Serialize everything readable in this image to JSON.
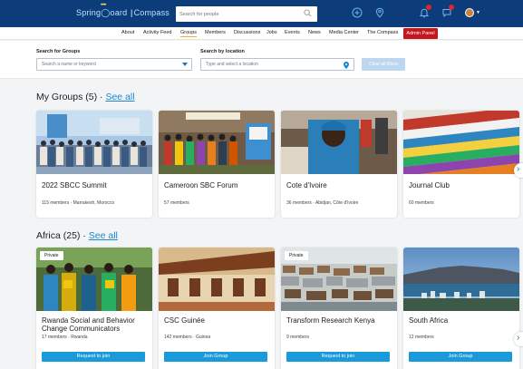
{
  "header": {
    "logo_part1": "Spring",
    "logo_part2": "oard",
    "logo_sep": "|",
    "logo_part3": "Compass",
    "search_placeholder": "Search for people",
    "icons": [
      "plus-circle-icon",
      "location-pin-icon",
      "bell-icon",
      "chat-icon",
      "avatar"
    ],
    "colors": {
      "bar": "#0c3d7a",
      "badge": "#e4212c"
    }
  },
  "nav": {
    "items": [
      "About",
      "Activity Feed",
      "Groups",
      "Members",
      "Discussions",
      "Jobs",
      "Events",
      "News",
      "Media Center",
      "The Compass"
    ],
    "active": "Groups",
    "admin_label": "Admin Panel"
  },
  "filters": {
    "search_label": "Search for Groups",
    "search_placeholder": "Search a name or keyword",
    "location_label": "Search by location",
    "location_placeholder": "Type and select a location",
    "clear_label": "Clear all filters"
  },
  "my_groups": {
    "title": "My Groups (5) · ",
    "see_all": "See all",
    "cards": [
      {
        "name": "2022 SBCC Summit",
        "meta": "115 members · Marrakesh, Morocco"
      },
      {
        "name": "Cameroon SBC Forum",
        "meta": "57 members"
      },
      {
        "name": "Cote d'Ivoire",
        "meta": "36 members · Abidjan, Côte d'Ivoire"
      },
      {
        "name": "Journal Club",
        "meta": "60 members"
      }
    ]
  },
  "africa": {
    "title": "Africa (25) · ",
    "see_all": "See all",
    "private_label": "Private",
    "cards": [
      {
        "name": "Rwanda Social and Behavior Change Communicators",
        "meta": "17 members · Rwanda",
        "button": "Request to join",
        "private": true
      },
      {
        "name": "CSC Guinée",
        "meta": "142 members · Guinea",
        "button": "Join Group",
        "private": false
      },
      {
        "name": "Transform Research Kenya",
        "meta": "9 members",
        "button": "Request to join",
        "private": true
      },
      {
        "name": "South Africa",
        "meta": "12 members",
        "button": "Join Group",
        "private": false
      }
    ]
  }
}
